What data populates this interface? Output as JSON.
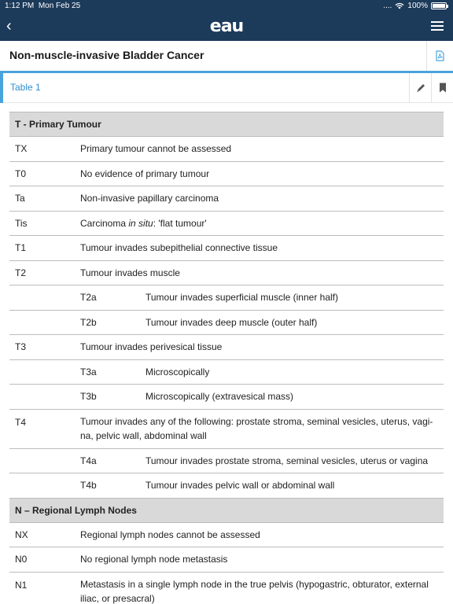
{
  "status": {
    "time": "1:12 PM",
    "date": "Mon Feb 25",
    "signal": "....",
    "battery": "100%"
  },
  "nav": {
    "logo": "eau"
  },
  "header": {
    "title": "Non-muscle-invasive Bladder Cancer"
  },
  "tab": {
    "label": "Table 1"
  },
  "table": {
    "sections": [
      {
        "title": "T - Primary Tumour",
        "rows": [
          {
            "code": "TX",
            "text": "Primary tumour cannot be assessed"
          },
          {
            "code": "T0",
            "text": "No evidence of primary tumour"
          },
          {
            "code": "Ta",
            "text": "Non-invasive papillary carcinoma"
          },
          {
            "code": "Tis",
            "text_prefix": "Carcinoma ",
            "text_em": "in situ",
            "text_suffix": ": 'flat tumour'"
          },
          {
            "code": "T1",
            "text": "Tumour invades subepithelial connective tissue"
          },
          {
            "code": "T2",
            "text": "Tumour invades muscle"
          },
          {
            "sub": "T2a",
            "text": "Tumour invades superficial muscle (inner half)"
          },
          {
            "sub": "T2b",
            "text": "Tumour invades deep muscle (outer half)"
          },
          {
            "code": "T3",
            "text": "Tumour invades perivesical tissue"
          },
          {
            "sub": "T3a",
            "text": "Microscopically"
          },
          {
            "sub": "T3b",
            "text": "Microscopically (extravesical mass)"
          },
          {
            "code": "T4",
            "text": "Tumour invades any of the following: prostate stroma, seminal vesicles, uterus, vagi-na, pelvic wall, abdominal wall"
          },
          {
            "sub": "T4a",
            "text": "Tumour invades prostate stroma, seminal vesicles, uterus or vagina"
          },
          {
            "sub": "T4b",
            "text": "Tumour invades pelvic wall or abdominal wall"
          }
        ]
      },
      {
        "title": "N – Regional Lymph Nodes",
        "rows": [
          {
            "code": "NX",
            "text": "Regional lymph nodes cannot be assessed"
          },
          {
            "code": "N0",
            "text": "No regional lymph node metastasis"
          },
          {
            "code": "N1",
            "text": "Metastasis in a single lymph node in the true pelvis (hypogastric, obturator, external iliac, or presacral)"
          }
        ]
      }
    ]
  }
}
